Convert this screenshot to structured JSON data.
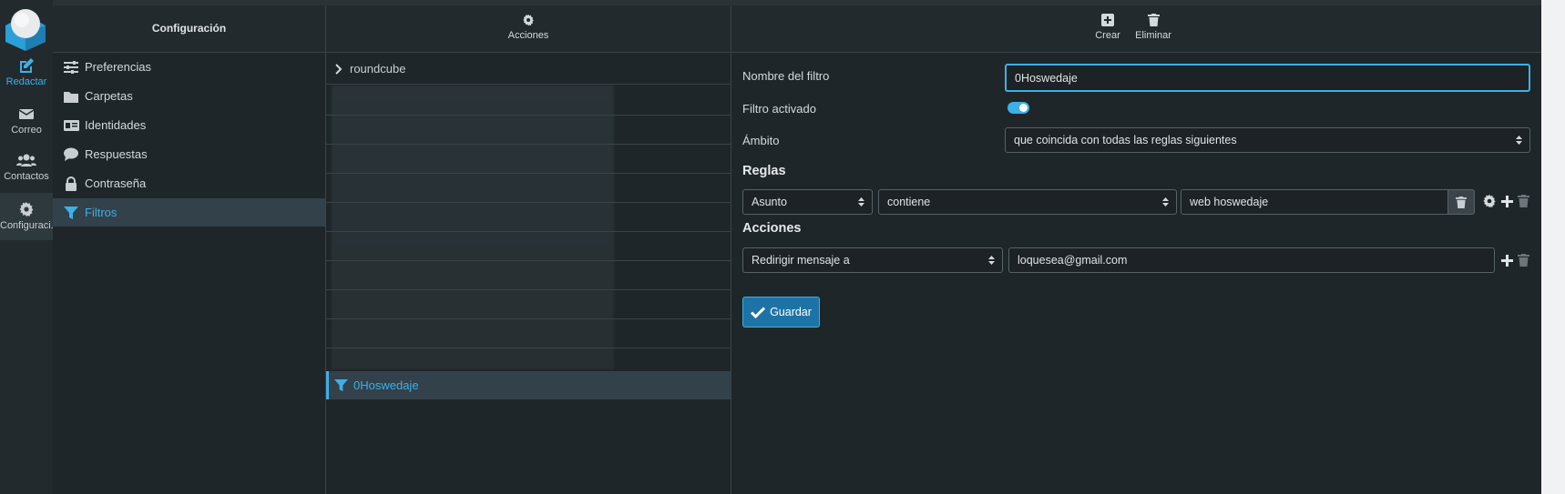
{
  "rail": {
    "items": [
      {
        "label": "Redactar",
        "icon": "compose-icon"
      },
      {
        "label": "Correo",
        "icon": "mail-icon"
      },
      {
        "label": "Contactos",
        "icon": "contacts-icon"
      },
      {
        "label": "Configuraci...",
        "icon": "gear-icon"
      }
    ]
  },
  "settings": {
    "title": "Configuración",
    "items": [
      {
        "label": "Preferencias",
        "icon": "sliders-icon"
      },
      {
        "label": "Carpetas",
        "icon": "folder-icon"
      },
      {
        "label": "Identidades",
        "icon": "id-card-icon"
      },
      {
        "label": "Respuestas",
        "icon": "comment-icon"
      },
      {
        "label": "Contraseña",
        "icon": "lock-icon"
      },
      {
        "label": "Filtros",
        "icon": "filter-icon"
      }
    ]
  },
  "filters_list": {
    "actions_label": "Acciones",
    "folder_label": "roundcube",
    "selected_filter": "0Hoswedaje"
  },
  "editor": {
    "create_label": "Crear",
    "delete_label": "Eliminar",
    "name_label": "Nombre del filtro",
    "name_value": "0Hoswedaje",
    "enabled_label": "Filtro activado",
    "enabled": true,
    "scope_label": "Ámbito",
    "scope_value": "que coincida con todas las reglas siguientes",
    "rules_title": "Reglas",
    "rule": {
      "header": "Asunto",
      "op": "contiene",
      "value": "web hoswedaje"
    },
    "actions_title": "Acciones",
    "action": {
      "type": "Redirigir mensaje a",
      "target": "loquesea@gmail.com"
    },
    "save_label": "Guardar"
  },
  "colors": {
    "accent": "#3eb0e5",
    "background": "#1f2629",
    "save_button": "#1e73a6"
  }
}
